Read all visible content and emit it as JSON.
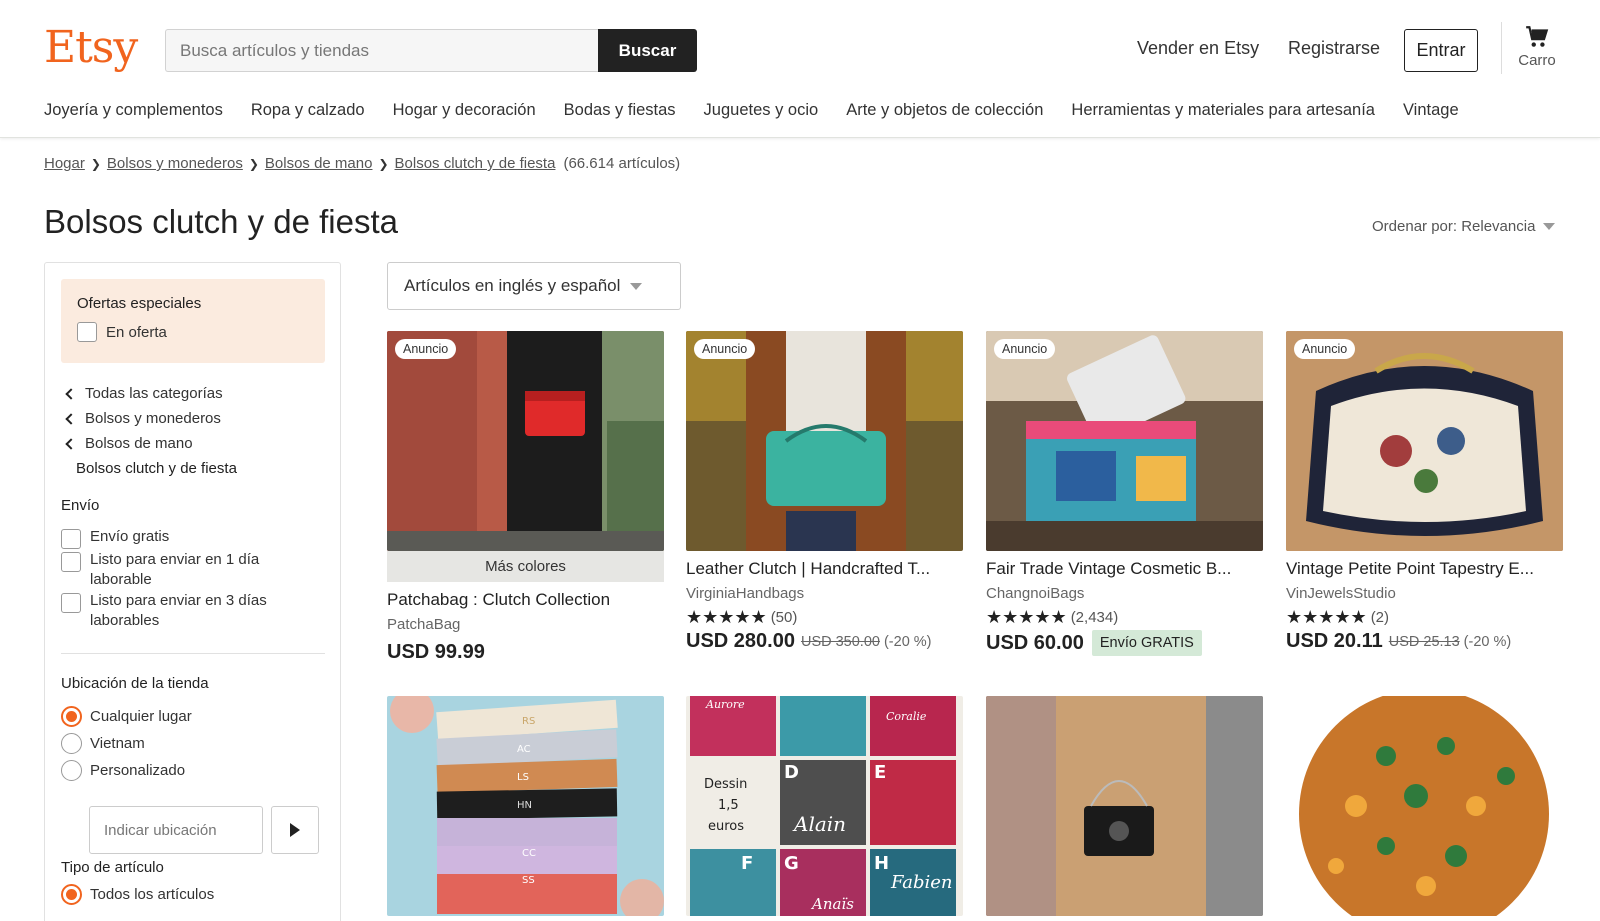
{
  "header": {
    "logo": "Etsy",
    "search_placeholder": "Busca artículos y tiendas",
    "search_button": "Buscar",
    "sell": "Vender en Etsy",
    "register": "Registrarse",
    "signin": "Entrar",
    "cart": "Carro"
  },
  "categories": [
    "Joyería y complementos",
    "Ropa y calzado",
    "Hogar y decoración",
    "Bodas y fiestas",
    "Juguetes y ocio",
    "Arte y objetos de colección",
    "Herramientas y materiales para artesanía",
    "Vintage"
  ],
  "breadcrumb": {
    "items": [
      "Hogar",
      "Bolsos y monederos",
      "Bolsos de mano",
      "Bolsos clutch y de fiesta"
    ],
    "count": "(66.614 artículos)"
  },
  "page_title": "Bolsos clutch y de fiesta",
  "sort": "Ordenar por: Relevancia",
  "sidebar": {
    "offers_title": "Ofertas especiales",
    "on_sale": "En oferta",
    "cat_nav": [
      "Todas las categorías",
      "Bolsos y monederos",
      "Bolsos de mano"
    ],
    "cat_current": "Bolsos clutch y de fiesta",
    "shipping_title": "Envío",
    "shipping": [
      "Envío gratis",
      "Listo para enviar en 1 día laborable",
      "Listo para enviar en 3 días laborables"
    ],
    "location_title": "Ubicación de la tienda",
    "locations": [
      "Cualquier lugar",
      "Vietnam",
      "Personalizado"
    ],
    "location_placeholder": "Indicar ubicación",
    "type_title": "Tipo de artículo",
    "types": [
      "Todos los artículos"
    ]
  },
  "language_select": "Artículos en inglés y español",
  "listings": [
    {
      "badge": "Anuncio",
      "more_colors": "Más colores",
      "title": "Patchabag : Clutch Collection",
      "shop": "PatchaBag",
      "price": "USD 99.99"
    },
    {
      "badge": "Anuncio",
      "title": "Leather Clutch | Handcrafted T...",
      "shop": "VirginiaHandbags",
      "stars": "★★★★★",
      "reviews": "(50)",
      "price": "USD 280.00",
      "old_price": "USD 350.00",
      "discount": "(-20 %)"
    },
    {
      "badge": "Anuncio",
      "title": "Fair Trade Vintage Cosmetic B...",
      "shop": "ChangnoiBags",
      "stars": "★★★★★",
      "reviews": "(2,434)",
      "price": "USD 60.00",
      "free_shipping": "Envío GRATIS"
    },
    {
      "badge": "Anuncio",
      "title": "Vintage Petite Point Tapestry E...",
      "shop": "VinJewelsStudio",
      "stars": "★★★★★",
      "reviews": "(2)",
      "price": "USD 20.11",
      "old_price": "USD 25.13",
      "discount": "(-20 %)"
    }
  ],
  "image_texts": {
    "initials": [
      "RS",
      "AC",
      "LS",
      "HN",
      "CC",
      "SS"
    ],
    "collage_names": [
      "Aurore",
      "Coralie",
      "Alain",
      "Fabien",
      "Anaïs"
    ],
    "collage_letters": [
      "D",
      "E",
      "F",
      "G",
      "H"
    ],
    "collage_note": [
      "Dessin",
      "1,5",
      "euros"
    ]
  }
}
